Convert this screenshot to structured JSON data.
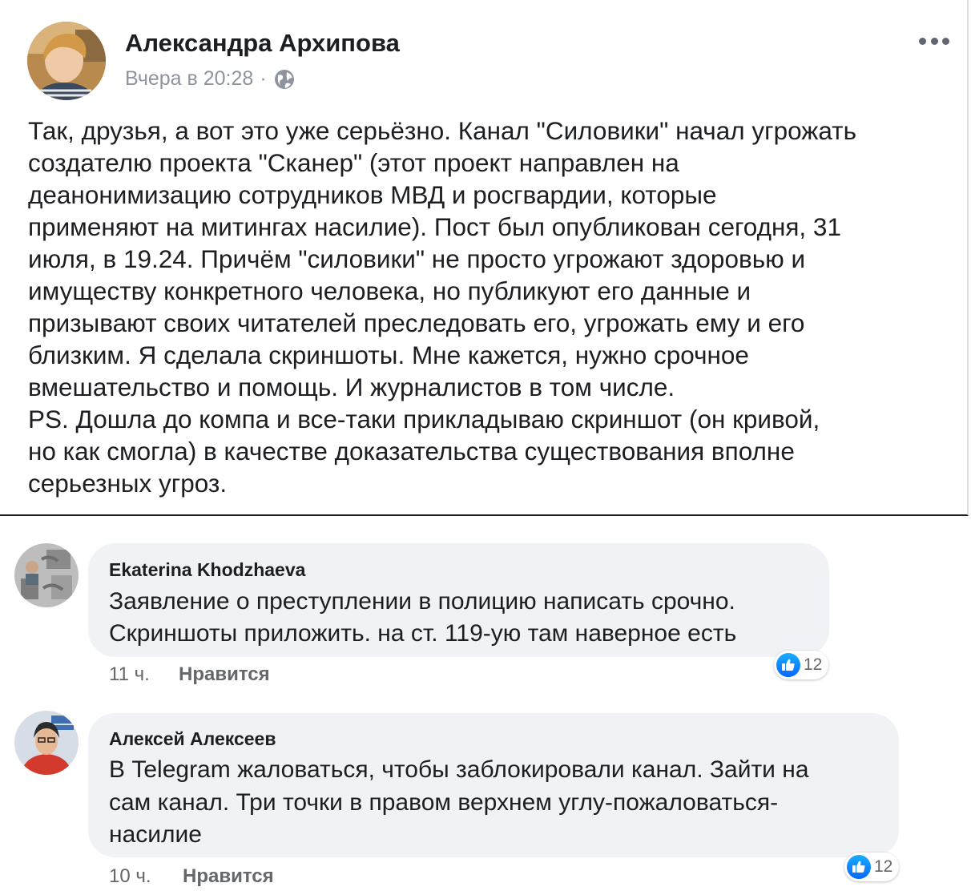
{
  "post": {
    "author": "Александра Архипова",
    "timestamp": "Вчера в 20:28",
    "separator": "·",
    "privacy_icon": "globe-icon",
    "more_icon": "more-options-icon",
    "lines": [
      "Так, друзья, а вот это уже серьёзно. Канал \"Силовики\" начал угрожать",
      "создателю проекта \"Сканер\" (этот проект направлен на",
      "деанонимизацию сотрудников МВД и росгвардии, которые",
      "применяют на митингах насилие). Пост был опубликован сегодня, 31",
      "июля, в 19.24. Причём \"силовики\" не просто угрожают здоровью и",
      "имуществу конкретного человека, но публикуют его данные и",
      "призывают своих читателей преследовать его, угрожать ему и его",
      "близким. Я сделала скриншоты. Мне кажется, нужно срочное",
      "вмешательство и помощь. И журналистов в том числе.",
      "PS. Дошла до компа и  все-таки прикладываю скриншот (он кривой,",
      "но как смогла) в качестве доказательства существования вполне",
      "серьезных угроз."
    ]
  },
  "comments": [
    {
      "author": "Ekaterina Khodzhaeva",
      "lines": [
        "Заявление о преступлении в полицию написать срочно.",
        "Скриншоты приложить. на ст. 119-ую там наверное есть"
      ],
      "time": "11 ч.",
      "like_label": "Нравится",
      "reaction_count": "12"
    },
    {
      "author": "Алексей Алексеев",
      "lines": [
        "В Telegram жаловаться, чтобы заблокировали канал. Зайти на",
        "сам канал. Три точки в правом верхнем углу-пожаловаться-",
        "насилие"
      ],
      "time": "10 ч.",
      "like_label": "Нравится",
      "reaction_count": "12"
    }
  ],
  "colors": {
    "bubble": "#f0f2f5",
    "meta_text": "#8d949e",
    "like_blue": "#0766ff"
  }
}
